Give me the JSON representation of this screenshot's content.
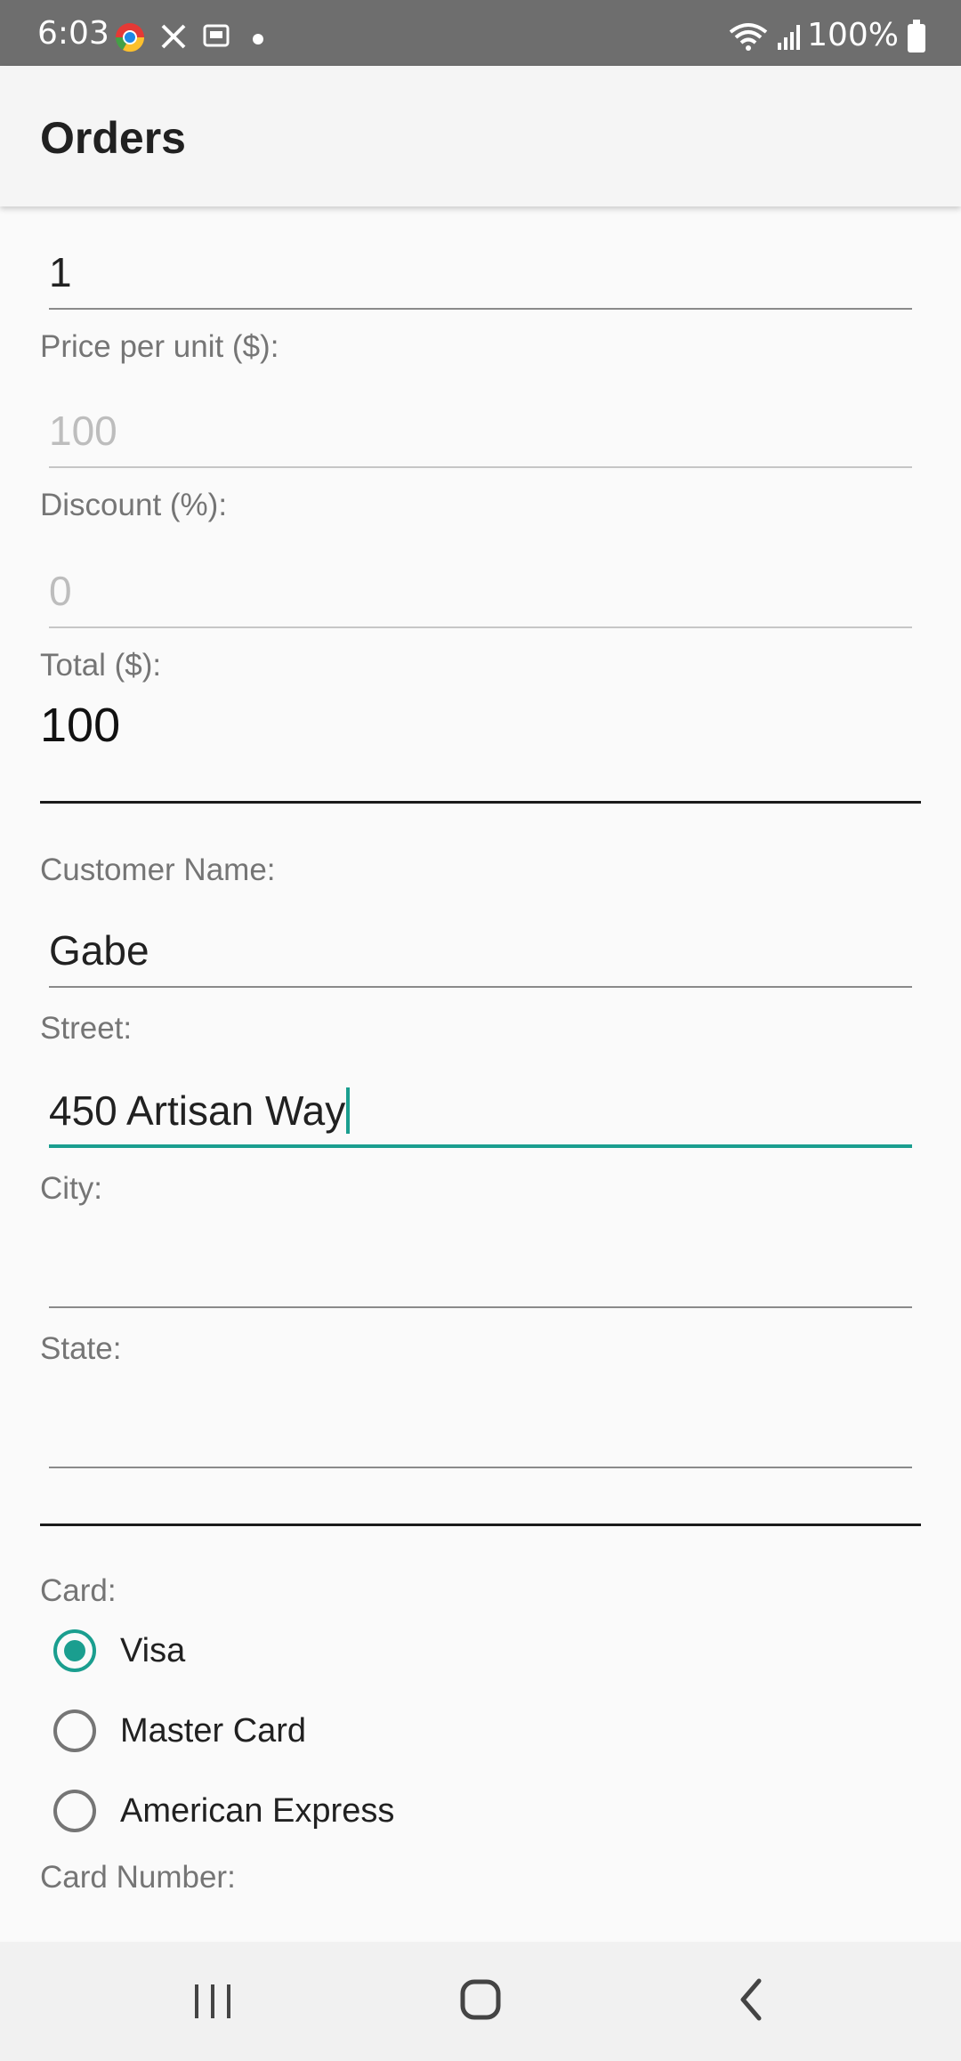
{
  "status_bar": {
    "time": "6:03",
    "battery": "100%",
    "icons": [
      "chrome-icon",
      "no-sim-icon",
      "screenshot-icon",
      "notification-dot",
      "wifi-icon",
      "signal-icon",
      "battery-icon"
    ]
  },
  "app_bar": {
    "title": "Orders"
  },
  "form": {
    "quantity_value": "1",
    "price_label": "Price per unit ($):",
    "price_value": "100",
    "discount_label": "Discount (%):",
    "discount_value": "0",
    "total_label": "Total ($):",
    "total_value": "100",
    "customer_name_label": "Customer Name:",
    "customer_name_value": "Gabe",
    "street_label": "Street:",
    "street_value": "450 Artisan Way",
    "city_label": "City:",
    "city_value": "",
    "state_label": "State:",
    "state_value": "",
    "card_label": "Card:",
    "card_options": [
      {
        "label": "Visa",
        "checked": true
      },
      {
        "label": "Master Card",
        "checked": false
      },
      {
        "label": "American Express",
        "checked": false
      }
    ],
    "card_number_label": "Card Number:"
  },
  "colors": {
    "accent": "#1a9e8f",
    "status_bar": "#6e6e6e",
    "app_bar": "#f5f5f5",
    "background": "#fafafa"
  }
}
